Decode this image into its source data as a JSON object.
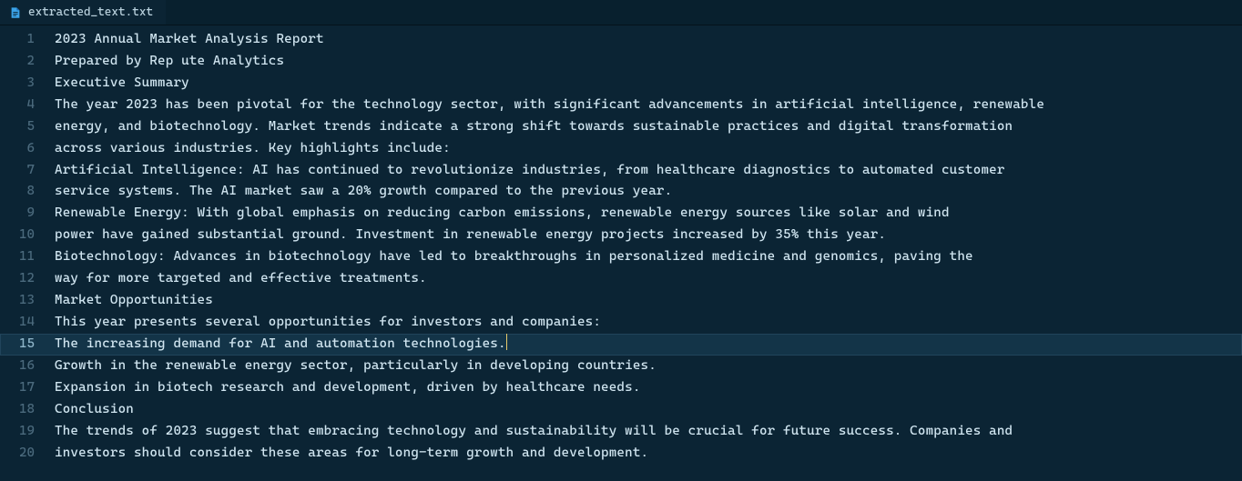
{
  "tab": {
    "filename": "extracted_text.txt"
  },
  "editor": {
    "current_line_index": 14,
    "lines": [
      {
        "n": "1",
        "text": "2023 Annual Market Analysis Report"
      },
      {
        "n": "2",
        "text": "Prepared by Rep ute Analytics"
      },
      {
        "n": "3",
        "text": "Executive Summary"
      },
      {
        "n": "4",
        "text": "The year 2023 has been pivotal for the technology sector, with significant advancements in artificial intelligence, renewable"
      },
      {
        "n": "5",
        "text": "energy, and biotechnology. Market trends indicate a strong shift towards sustainable practices and digital transformation"
      },
      {
        "n": "6",
        "text": "across various industries. Key highlights include:"
      },
      {
        "n": "7",
        "text": "Artificial Intelligence: AI has continued to revolutionize industries, from healthcare diagnostics to automated customer"
      },
      {
        "n": "8",
        "text": "service systems. The AI market saw a 20% growth compared to the previous year."
      },
      {
        "n": "9",
        "text": "Renewable Energy: With global emphasis on reducing carbon emissions, renewable energy sources like solar and wind"
      },
      {
        "n": "10",
        "text": "power have gained substantial ground. Investment in renewable energy projects increased by 35% this year."
      },
      {
        "n": "11",
        "text": "Biotechnology: Advances in biotechnology have led to breakthroughs in personalized medicine and genomics, paving the"
      },
      {
        "n": "12",
        "text": "way for more targeted and effective treatments."
      },
      {
        "n": "13",
        "text": "Market Opportunities"
      },
      {
        "n": "14",
        "text": "This year presents several opportunities for investors and companies:"
      },
      {
        "n": "15",
        "text": "The increasing demand for AI and automation technologies."
      },
      {
        "n": "16",
        "text": "Growth in the renewable energy sector, particularly in developing countries."
      },
      {
        "n": "17",
        "text": "Expansion in biotech research and development, driven by healthcare needs."
      },
      {
        "n": "18",
        "text": "Conclusion"
      },
      {
        "n": "19",
        "text": "The trends of 2023 suggest that embracing technology and sustainability will be crucial for future success. Companies and"
      },
      {
        "n": "20",
        "text": "investors should consider these areas for long-term growth and development."
      }
    ]
  }
}
